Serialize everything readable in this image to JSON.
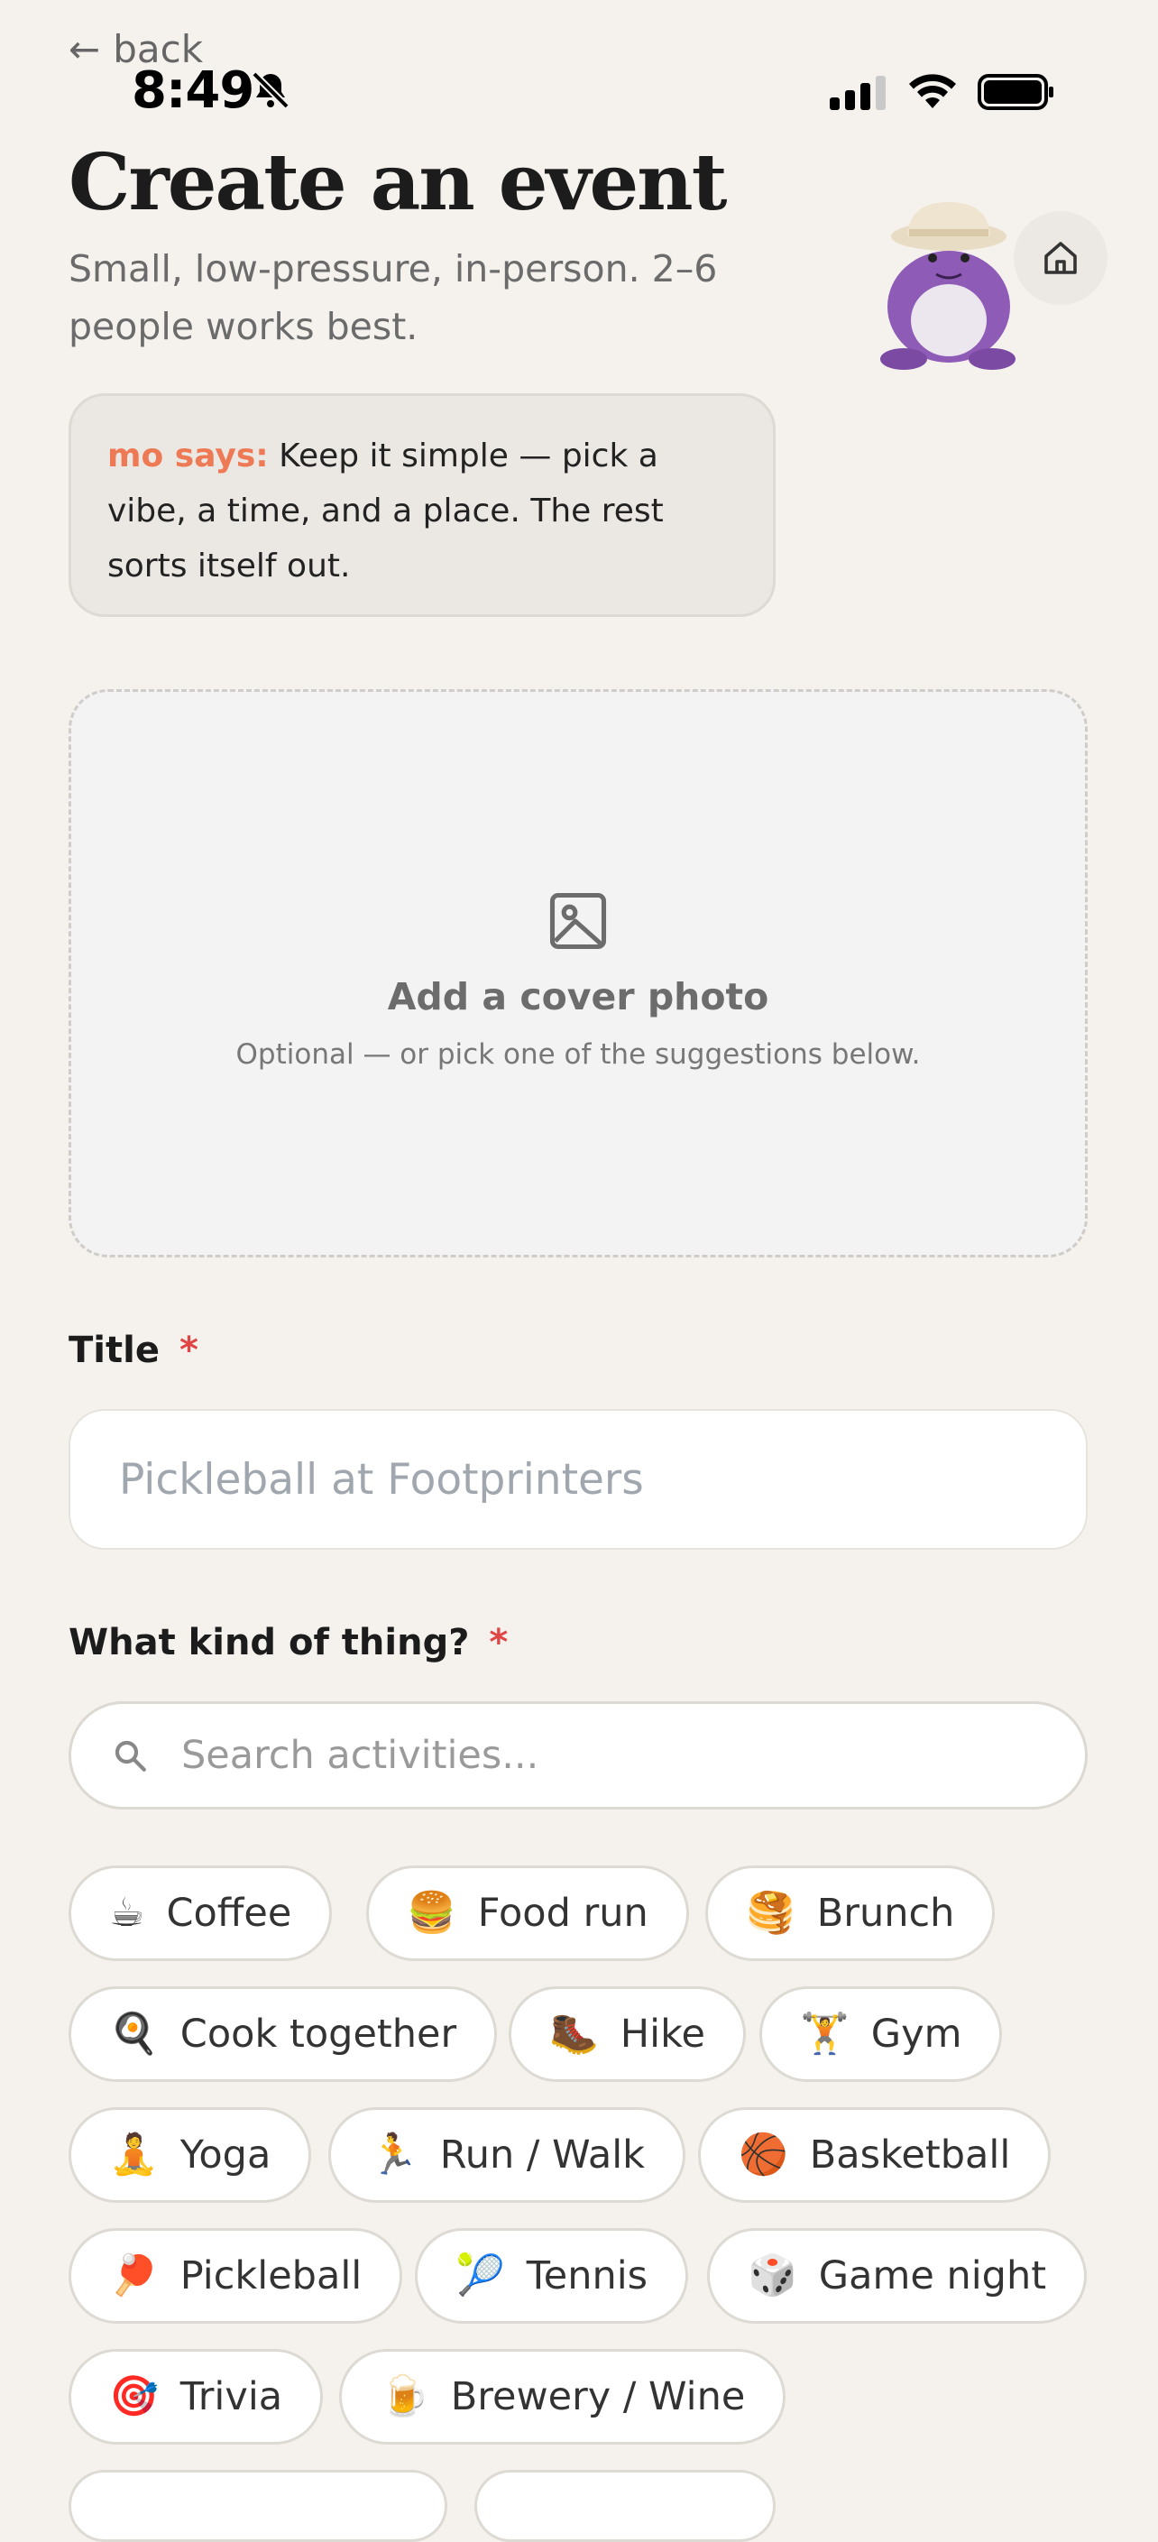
{
  "nav": {
    "back_label": "back",
    "back_arrow": "←"
  },
  "status_bar": {
    "time": "8:49"
  },
  "header": {
    "title": "Create an event",
    "subtitle": "Small, low-pressure, in-person. 2–6 people works best."
  },
  "tip": {
    "speaker": "mo says:",
    "text": "Keep it simple — pick a vibe, a time, and a place. The rest sorts itself out."
  },
  "cover": {
    "title": "Add a cover photo",
    "subtitle": "Optional — or pick one of the suggestions below."
  },
  "form": {
    "title_label": "Title",
    "required_mark": "*",
    "title_placeholder": "Pickleball at Footprinters",
    "kind_label": "What kind of thing?",
    "search_placeholder": "Search activities..."
  },
  "activities": [
    {
      "emoji": "☕",
      "label": "Coffee",
      "icon": "coffee-icon"
    },
    {
      "emoji": "🍔",
      "label": "Food run",
      "icon": "burger-icon"
    },
    {
      "emoji": "🥞",
      "label": "Brunch",
      "icon": "pancakes-icon"
    },
    {
      "emoji": "🍳",
      "label": "Cook together",
      "icon": "frying-pan-icon"
    },
    {
      "emoji": "🥾",
      "label": "Hike",
      "icon": "hiking-boot-icon"
    },
    {
      "emoji": "🏋️",
      "label": "Gym",
      "icon": "weightlifter-icon"
    },
    {
      "emoji": "🧘",
      "label": "Yoga",
      "icon": "yoga-icon"
    },
    {
      "emoji": "🏃",
      "label": "Run / Walk",
      "icon": "runner-icon"
    },
    {
      "emoji": "🏀",
      "label": "Basketball",
      "icon": "basketball-icon"
    },
    {
      "emoji": "🏓",
      "label": "Pickleball",
      "icon": "paddle-icon"
    },
    {
      "emoji": "🎾",
      "label": "Tennis",
      "icon": "tennis-ball-icon"
    },
    {
      "emoji": "🎲",
      "label": "Game night",
      "icon": "dice-icon"
    },
    {
      "emoji": "🎯",
      "label": "Trivia",
      "icon": "target-icon"
    },
    {
      "emoji": "🍺",
      "label": "Brewery / Wine",
      "icon": "beer-icon"
    }
  ],
  "colors": {
    "accent": "#ee7a55",
    "required": "#e04545",
    "background": "#f5f2ee",
    "mascot": "#8e5bb6"
  }
}
